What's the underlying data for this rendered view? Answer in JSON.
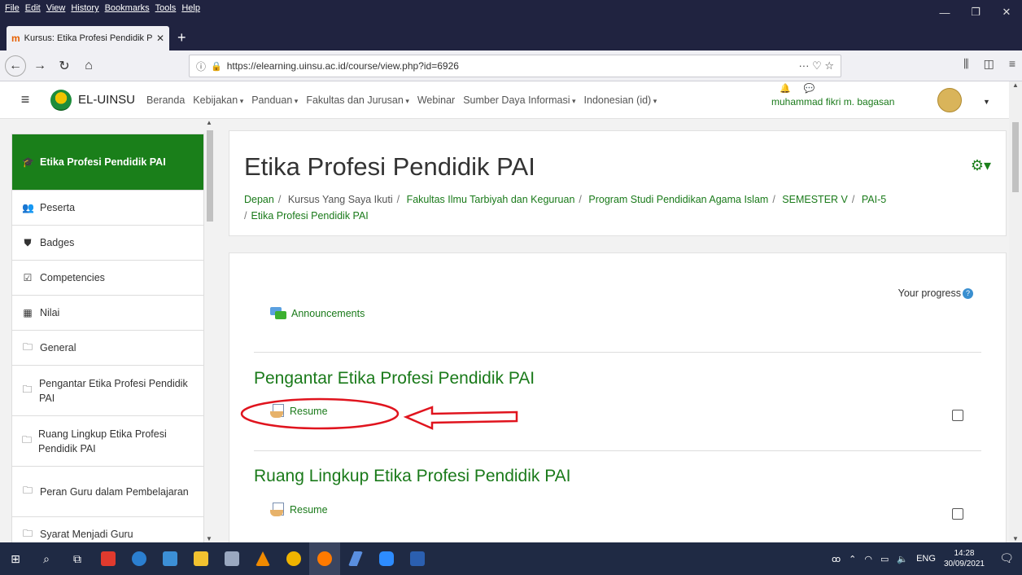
{
  "browser": {
    "menu": [
      "File",
      "Edit",
      "View",
      "History",
      "Bookmarks",
      "Tools",
      "Help"
    ],
    "tab_title": "Kursus: Etika Profesi Pendidik P",
    "url": "https://elearning.uinsu.ac.id/course/view.php?id=6926",
    "url_actions": "··· ♡ ☆"
  },
  "header": {
    "site_name": "EL-UINSU",
    "nav": [
      "Beranda",
      "Kebijakan",
      "Panduan",
      "Fakultas dan Jurusan",
      "Webinar",
      "Sumber Daya Informasi",
      "Indonesian (id)"
    ],
    "user_name": "muhammad fikri m. bagasan"
  },
  "drawer": {
    "active": "Etika Profesi Pendidik PAI",
    "items": [
      {
        "icon": "users-icon",
        "label": "Peserta"
      },
      {
        "icon": "shield-icon",
        "label": "Badges"
      },
      {
        "icon": "checkbox-icon",
        "label": "Competencies"
      },
      {
        "icon": "table-icon",
        "label": "Nilai"
      },
      {
        "icon": "folder-icon",
        "label": "General"
      },
      {
        "icon": "folder-icon",
        "label": "Pengantar Etika Profesi Pendidik PAI"
      },
      {
        "icon": "folder-icon",
        "label": "Ruang Lingkup Etika Profesi Pendidik PAI"
      },
      {
        "icon": "folder-icon",
        "label": "Peran Guru dalam Pembelajaran"
      },
      {
        "icon": "folder-icon",
        "label": "Syarat Menjadi Guru"
      }
    ]
  },
  "main": {
    "title": "Etika Profesi Pendidik PAI",
    "breadcrumb": [
      "Depan",
      "Kursus Yang Saya Ikuti",
      "Fakultas Ilmu Tarbiyah dan Keguruan",
      "Program Studi Pendidikan Agama Islam",
      "SEMESTER V",
      "PAI-5",
      "Etika Profesi Pendidik PAI"
    ],
    "progress_label": "Your progress",
    "announcements": "Announcements",
    "sections": [
      {
        "title": "Pengantar Etika Profesi Pendidik PAI",
        "activity": "Resume"
      },
      {
        "title": "Ruang Lingkup Etika Profesi Pendidik PAI",
        "activity": "Resume"
      }
    ]
  },
  "taskbar": {
    "lang": "ENG",
    "time": "14:28",
    "date": "30/09/2021"
  }
}
